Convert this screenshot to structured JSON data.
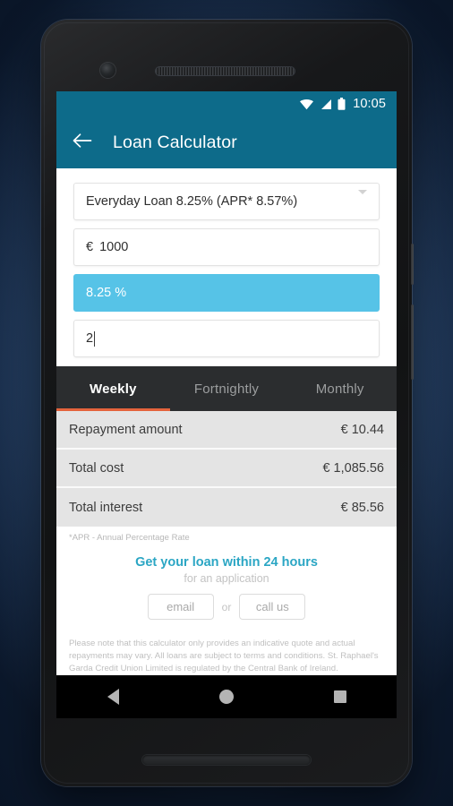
{
  "status_bar": {
    "time": "10:05",
    "icons": [
      "wifi-icon",
      "signal-icon",
      "battery-icon"
    ]
  },
  "app_bar": {
    "back_label": "back-arrow",
    "title": "Loan Calculator"
  },
  "form": {
    "loan_type": {
      "value": "Everyday Loan 8.25% (APR* 8.57%)",
      "caret": "chevron-down-icon"
    },
    "amount": {
      "currency": "€",
      "value": "1000"
    },
    "rate": {
      "value": "8.25 %"
    },
    "term": {
      "value": "2"
    }
  },
  "tabs": [
    {
      "label": "Weekly",
      "active": true
    },
    {
      "label": "Fortnightly",
      "active": false
    },
    {
      "label": "Monthly",
      "active": false
    }
  ],
  "results": [
    {
      "label": "Repayment amount",
      "value": "€ 10.44"
    },
    {
      "label": "Total cost",
      "value": "€ 1,085.56"
    },
    {
      "label": "Total interest",
      "value": "€ 85.56"
    }
  ],
  "apr_note": "*APR - Annual Percentage Rate",
  "cta": {
    "heading": "Get your loan within 24 hours",
    "subheading": "for an application",
    "email_label": "email",
    "or_label": "or",
    "call_label": "call us"
  },
  "disclaimer": "Please note that this calculator only provides an indicative quote and actual repayments may vary. All loans are subject to terms and conditions. St. Raphael's Garda Credit Union Limited is regulated by the Central Bank of Ireland.",
  "nav_bar": {
    "back": "back-triangle-icon",
    "home": "home-circle-icon",
    "recents": "recents-square-icon"
  },
  "colors": {
    "header_teal": "#0d6b8a",
    "highlight_blue": "#56c3e7",
    "tab_bar_dark": "#2b2d2f",
    "tab_indicator_orange": "#e4633c",
    "cta_teal": "#2ba6c4",
    "row_gray": "#e4e4e4"
  }
}
